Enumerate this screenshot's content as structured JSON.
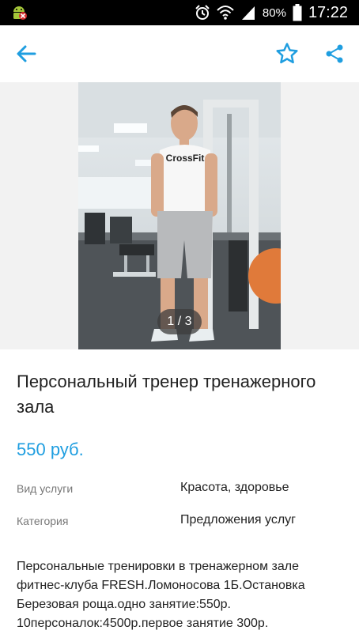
{
  "status_bar": {
    "battery_percent": "80%",
    "time": "17:22"
  },
  "app_bar": {
    "icons": [
      "back-arrow-icon",
      "star-icon",
      "share-icon"
    ],
    "accent_color": "#1f9ee0"
  },
  "gallery": {
    "page_indicator": "1 / 3",
    "shirt_text": "CrossFit"
  },
  "listing": {
    "title": "Персональный тренер тренажерного зала",
    "price": "550 руб.",
    "properties": [
      {
        "label": "Вид услуги",
        "value": "Красота, здоровье"
      },
      {
        "label": "Категория",
        "value": "Предложения услуг"
      }
    ],
    "description": "Персональные тренировки в тренажерном зале фитнес-клуба FRESH.Ломоносова 1Б.Остановка Березовая роща.одно занятие:550р. 10персоналок:4500р.первое занятие 300р."
  }
}
